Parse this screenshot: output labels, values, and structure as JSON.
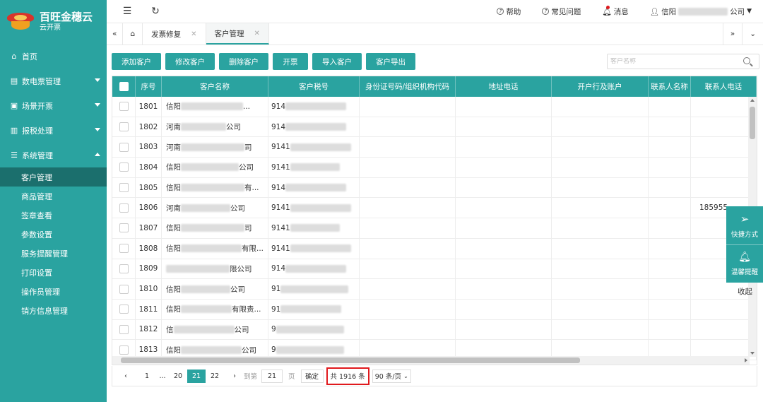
{
  "app": {
    "name": "百旺金穗云",
    "sub": "云开票"
  },
  "topbar": {
    "help": "帮助",
    "faq": "常见问题",
    "messages": "消息",
    "user_prefix": "信阳",
    "user_suffix": "公司"
  },
  "tabs": [
    {
      "label": "发票修复",
      "active": false
    },
    {
      "label": "客户管理",
      "active": true
    }
  ],
  "sidebar": {
    "home": "首页",
    "groups": [
      {
        "label": "数电票管理",
        "icon": "invoice-icon",
        "expanded": false
      },
      {
        "label": "场景开票",
        "icon": "scene-icon",
        "expanded": false
      },
      {
        "label": "报税处理",
        "icon": "tax-icon",
        "expanded": false
      },
      {
        "label": "系统管理",
        "icon": "settings-icon",
        "expanded": true
      }
    ],
    "sub_items": [
      "客户管理",
      "商品管理",
      "签章查看",
      "参数设置",
      "服务提醒管理",
      "打印设置",
      "操作员管理",
      "销方信息管理"
    ]
  },
  "toolbar": {
    "add": "添加客户",
    "edit": "修改客户",
    "delete": "删除客户",
    "issue": "开票",
    "import": "导入客户",
    "export": "客户导出"
  },
  "search": {
    "placeholder": "客户名称"
  },
  "table": {
    "columns": [
      "序号",
      "客户名称",
      "客户税号",
      "身份证号码/组织机构代码",
      "地址电话",
      "开户行及账户",
      "联系人名称",
      "联系人电话"
    ],
    "rows": [
      {
        "no": "1801",
        "name_pre": "信阳",
        "name_post": "...",
        "tax": "914",
        "phone": ""
      },
      {
        "no": "1802",
        "name_pre": "河南",
        "name_post": "公司",
        "tax": "914",
        "phone": ""
      },
      {
        "no": "1803",
        "name_pre": "河南",
        "name_post": "司",
        "tax": "9141",
        "phone": ""
      },
      {
        "no": "1804",
        "name_pre": "信阳",
        "name_post": "公司",
        "tax": "9141",
        "phone": ""
      },
      {
        "no": "1805",
        "name_pre": "信阳",
        "name_post": "有...",
        "tax": "914",
        "phone": ""
      },
      {
        "no": "1806",
        "name_pre": "河南",
        "name_post": "公司",
        "tax": "9141",
        "phone": "185955"
      },
      {
        "no": "1807",
        "name_pre": "信阳",
        "name_post": "司",
        "tax": "9141",
        "phone": ""
      },
      {
        "no": "1808",
        "name_pre": "信阳",
        "name_post": "有限...",
        "tax": "9141",
        "phone": ""
      },
      {
        "no": "1809",
        "name_pre": "",
        "name_post": "限公司",
        "tax": "914",
        "phone": ""
      },
      {
        "no": "1810",
        "name_pre": "信阳",
        "name_post": "公司",
        "tax": "91",
        "phone": ""
      },
      {
        "no": "1811",
        "name_pre": "信阳",
        "name_post": "有限责...",
        "tax": "91",
        "phone": ""
      },
      {
        "no": "1812",
        "name_pre": "信",
        "name_post": "公司",
        "tax": "9",
        "phone": ""
      },
      {
        "no": "1813",
        "name_pre": "信阳",
        "name_post": "公司",
        "tax": "9",
        "phone": ""
      }
    ]
  },
  "pager": {
    "first": "1",
    "ellipsis": "...",
    "prev_page": "20",
    "current": "21",
    "next_page": "22",
    "goto_label": "到第",
    "goto_value": "21",
    "page_unit": "页",
    "confirm": "确定",
    "total": "共 1916 条",
    "per_page": "90 条/页"
  },
  "float_panel": {
    "shortcut": "快捷方式",
    "reminder": "温馨提醒",
    "collapse": "收起"
  },
  "colors": {
    "primary": "#2aa3a0",
    "active_nav": "#1b6f6d",
    "highlight": "#e0191d"
  }
}
